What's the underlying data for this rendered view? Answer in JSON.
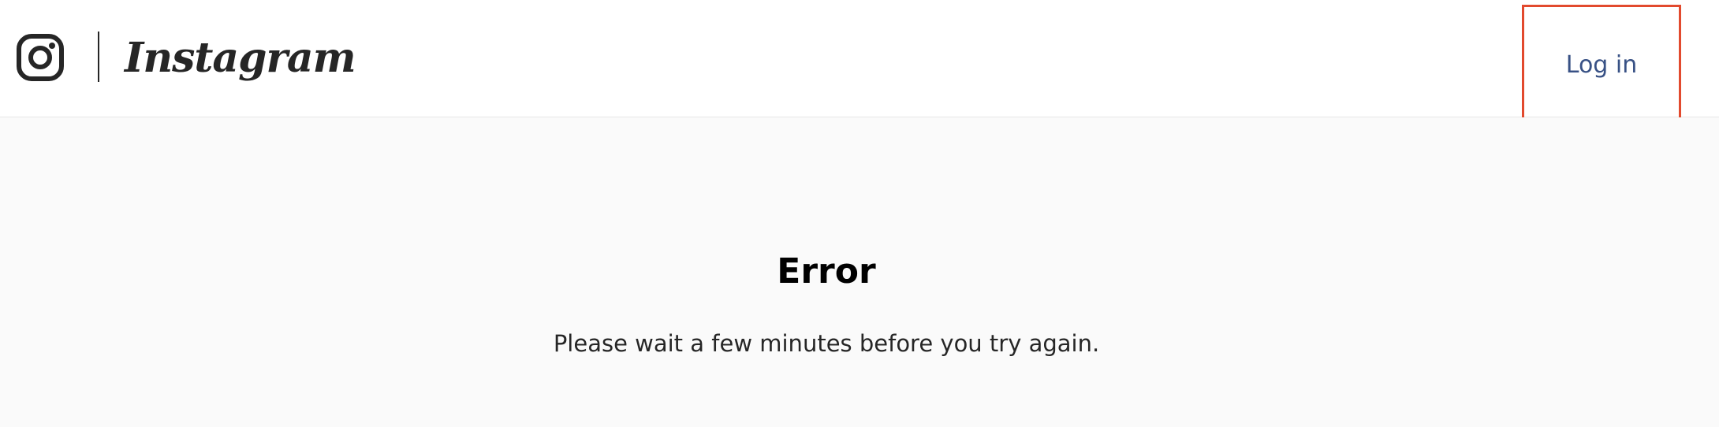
{
  "header": {
    "brand": "Instagram",
    "login_label": "Log in"
  },
  "main": {
    "error_title": "Error",
    "error_message": "Please wait a few minutes before you try again."
  },
  "colors": {
    "link": "#385185",
    "highlight_border": "#e24a2e",
    "page_bg": "#fafafa",
    "header_bg": "#ffffff"
  },
  "icons": {
    "logo": "instagram-logo-icon"
  }
}
